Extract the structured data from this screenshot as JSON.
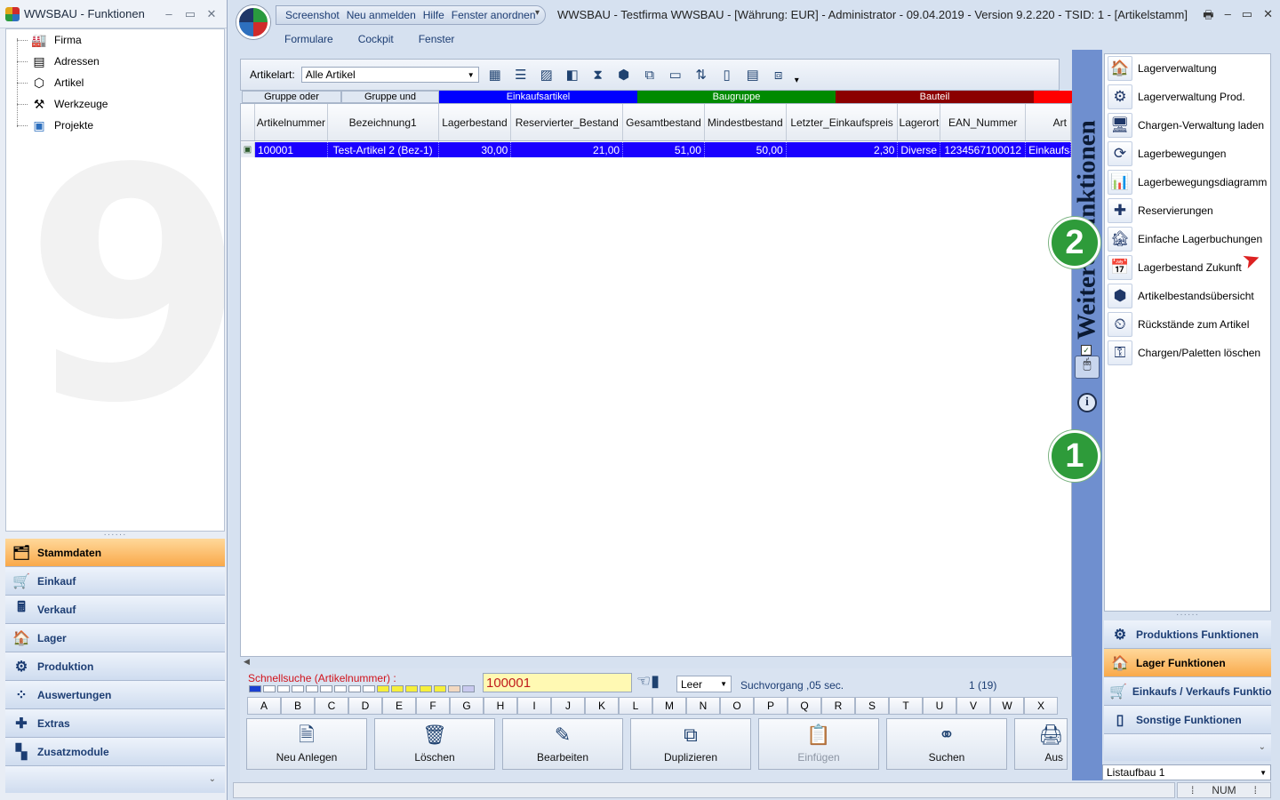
{
  "left_window": {
    "title": "WWSBAU - Funktionen",
    "controls": {
      "minimize": "–",
      "maximize": "▭",
      "close": "✕"
    },
    "tree_items": [
      {
        "label": "Firma",
        "icon": "factory-icon"
      },
      {
        "label": "Adressen",
        "icon": "address-card-icon"
      },
      {
        "label": "Artikel",
        "icon": "box-icon"
      },
      {
        "label": "Werkzeuge",
        "icon": "tools-icon"
      },
      {
        "label": "Projekte",
        "icon": "project-icon"
      }
    ],
    "nav_groups": [
      {
        "label": "Stammdaten",
        "active": true
      },
      {
        "label": "Einkauf"
      },
      {
        "label": "Verkauf"
      },
      {
        "label": "Lager"
      },
      {
        "label": "Produktion"
      },
      {
        "label": "Auswertungen"
      },
      {
        "label": "Extras"
      },
      {
        "label": "Zusatzmodule"
      }
    ],
    "nav_bottom": "⌄"
  },
  "main": {
    "quickbar": [
      "Screenshot",
      "Neu anmelden",
      "Hilfe",
      "Fenster anordnen"
    ],
    "quickbar_dropdown": "▾",
    "title": "WWSBAU - Testfirma WWSBAU - [Währung: EUR] - Administrator - 09.04.2019 - Version 9.2.220 - TSID: 1  - [Artikelstamm]",
    "controls": {
      "print": "🖶",
      "minimize": "–",
      "maximize": "▭",
      "close": "✕"
    },
    "menu": [
      "Formulare",
      "Cockpit",
      "Fenster"
    ],
    "toolbar": {
      "article_type_label": "Artikelart:",
      "article_type_value": "Alle Artikel",
      "dropdown_arrow": "▼",
      "overflow": "▾"
    },
    "group_row": [
      {
        "label": "Gruppe oder",
        "color": "#dfe7f2",
        "text": "#000"
      },
      {
        "label": "Gruppe und",
        "color": "#dfe7f2",
        "text": "#000"
      },
      {
        "label": "Einkaufsartikel",
        "color": "#0000ff",
        "text": "#ffffff"
      },
      {
        "label": "Baugruppe",
        "color": "#008a00",
        "text": "#ffffff"
      },
      {
        "label": "Bauteil",
        "color": "#8b0000",
        "text": "#ffffff"
      },
      {
        "label": "",
        "color": "#ff0000",
        "text": "#ffffff"
      }
    ],
    "table": {
      "columns": [
        "Artikelnummer",
        "Bezeichnung1",
        "Lagerbestand",
        "Reservierter_Bestand",
        "Gesamtbestand",
        "Mindestbestand",
        "Letzter_Einkaufspreis",
        "Lagerort",
        "EAN_Nummer",
        "Art"
      ],
      "rows": [
        [
          "100001",
          "Test-Artikel 2 (Bez-1)",
          "30,00",
          "21,00",
          "51,00",
          "50,00",
          "2,30",
          "Diverse",
          "1234567100012",
          "Einkaufsa"
        ]
      ],
      "scroll_left": "◀"
    },
    "quicksearch": {
      "label": "Schnellsuche (Artikelnummer) :",
      "value": "100001",
      "filter_value": "Leer",
      "status": "Suchvorgang ,05 sec.",
      "count": "1  (19)",
      "dropdown_arrow": "▼"
    },
    "letters": [
      "A",
      "B",
      "C",
      "D",
      "E",
      "F",
      "G",
      "H",
      "I",
      "J",
      "K",
      "L",
      "M",
      "N",
      "O",
      "P",
      "Q",
      "R",
      "S",
      "T",
      "U",
      "V",
      "W",
      "X"
    ],
    "actions": [
      {
        "label": "Neu Anlegen",
        "icon": "new-document-icon"
      },
      {
        "label": "Löschen",
        "icon": "trash-icon"
      },
      {
        "label": "Bearbeiten",
        "icon": "edit-icon"
      },
      {
        "label": "Duplizieren",
        "icon": "duplicate-icon"
      },
      {
        "label": "Einfügen",
        "icon": "paste-icon",
        "disabled": true
      },
      {
        "label": "Suchen",
        "icon": "binoculars-icon"
      },
      {
        "label": "Aus",
        "icon": "export-icon"
      }
    ]
  },
  "functions_panel": {
    "vertical_title": "Weitere Funktionen",
    "checkbox_mark": "✓",
    "mouse_glyph": "🖱",
    "info_glyph": "i",
    "items": [
      "Lagerverwaltung",
      "Lagerverwaltung Prod.",
      "Chargen-Verwaltung laden",
      "Lagerbewegungen",
      "Lagerbewegungsdiagramm",
      "Reservierungen",
      "Einfache Lagerbuchungen",
      "Lagerbestand Zukunft",
      "Artikelbestandsübersicht",
      "Rückstände zum Artikel",
      "Chargen/Paletten löschen"
    ],
    "groups": [
      {
        "label": "Produktions Funktionen"
      },
      {
        "label": "Lager Funktionen",
        "active": true
      },
      {
        "label": "Einkaufs / Verkaufs Funktio..."
      },
      {
        "label": "Sonstige Funktionen"
      }
    ],
    "group_bottom": "⌄",
    "list_layout": "Listaufbau 1",
    "dropdown_arrow": "▼"
  },
  "markers": {
    "one": "1",
    "two": "2"
  },
  "statusbar": {
    "num": "NUM",
    "sep": "⁞"
  }
}
